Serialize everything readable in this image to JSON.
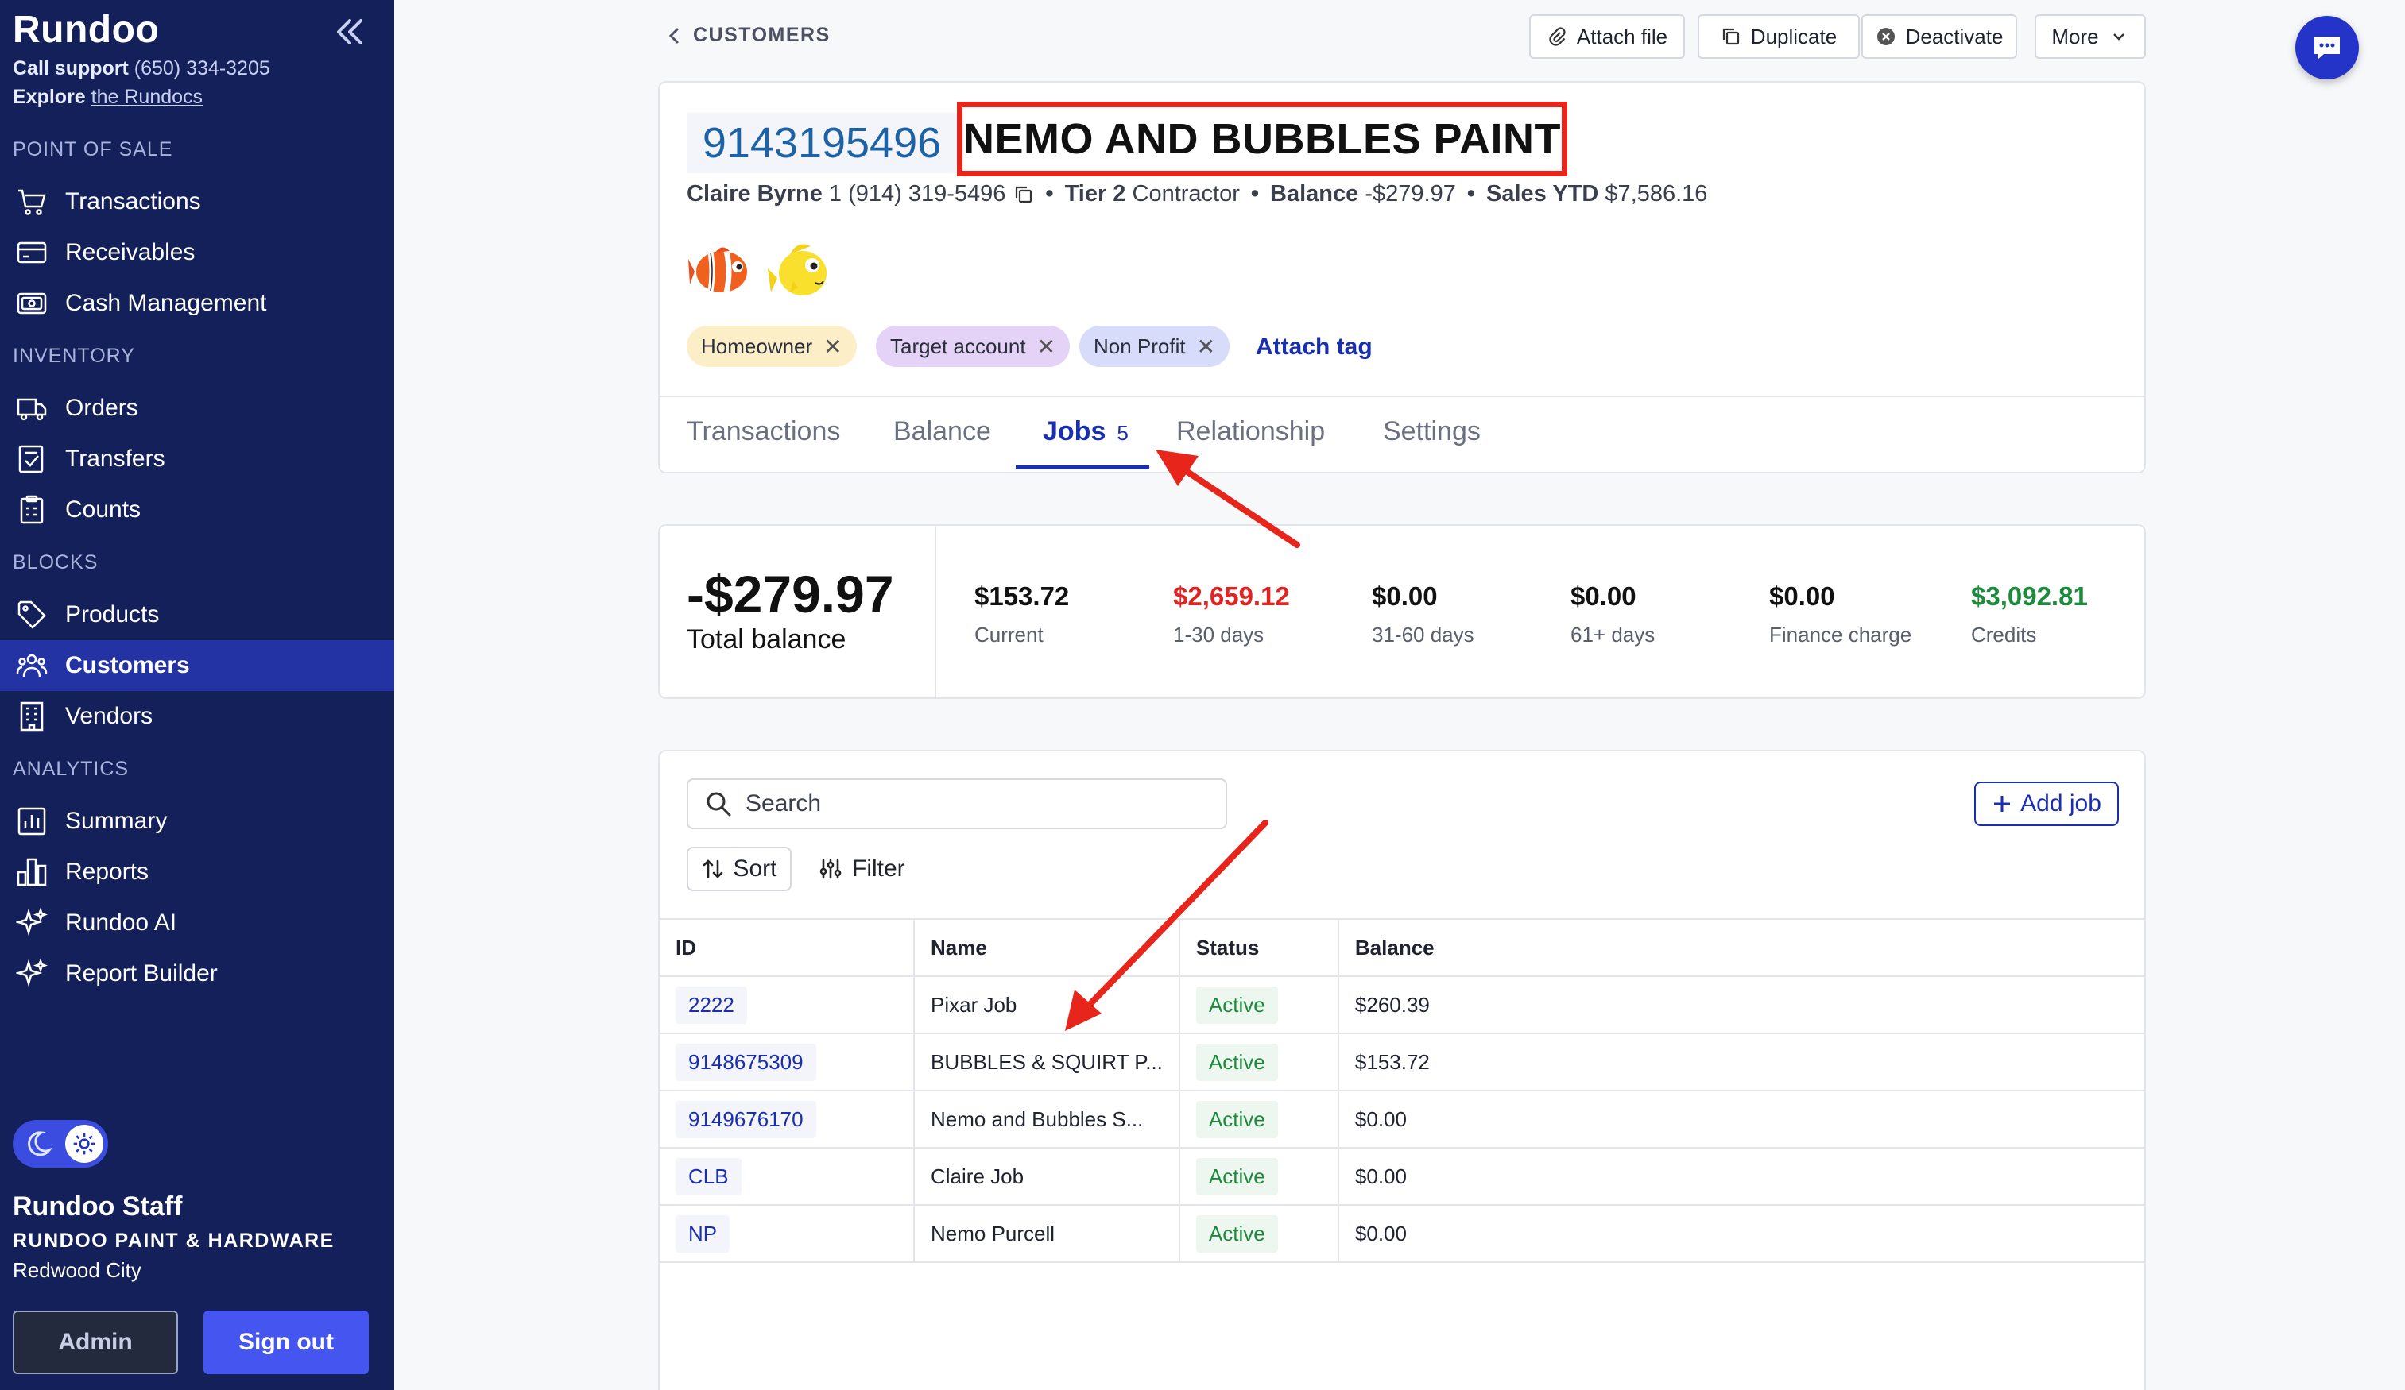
{
  "sidebar": {
    "brand": "Rundoo",
    "support_label": "Call support",
    "support_phone": "(650) 334-3205",
    "explore_label": "Explore",
    "explore_link": "the Rundocs",
    "sections": [
      {
        "label": "POINT OF SALE"
      },
      {
        "label": "INVENTORY"
      },
      {
        "label": "BLOCKS"
      },
      {
        "label": "ANALYTICS"
      }
    ],
    "items": [
      {
        "label": "Transactions",
        "icon": "cart-icon"
      },
      {
        "label": "Receivables",
        "icon": "card-icon"
      },
      {
        "label": "Cash Management",
        "icon": "cash-icon"
      },
      {
        "label": "Orders",
        "icon": "truck-icon"
      },
      {
        "label": "Transfers",
        "icon": "transfer-icon"
      },
      {
        "label": "Counts",
        "icon": "clipboard-icon"
      },
      {
        "label": "Products",
        "icon": "tag-icon"
      },
      {
        "label": "Customers",
        "icon": "users-icon",
        "active": true
      },
      {
        "label": "Vendors",
        "icon": "building-icon"
      },
      {
        "label": "Summary",
        "icon": "chart-icon"
      },
      {
        "label": "Reports",
        "icon": "bars-icon"
      },
      {
        "label": "Rundoo AI",
        "icon": "sparkle-icon"
      },
      {
        "label": "Report Builder",
        "icon": "sparkle-icon"
      }
    ],
    "user_name": "Rundoo Staff",
    "user_org": "RUNDOO PAINT & HARDWARE",
    "user_city": "Redwood City",
    "admin_label": "Admin",
    "signout_label": "Sign out"
  },
  "topbar": {
    "breadcrumb": "CUSTOMERS",
    "attach_file": "Attach file",
    "duplicate": "Duplicate",
    "deactivate": "Deactivate",
    "more": "More"
  },
  "customer": {
    "account_number": "9143195496",
    "name": "NEMO AND BUBBLES PAINT",
    "contact_name": "Claire Byrne",
    "contact_phone": "1 (914) 319-5496",
    "tier_label": "Tier 2",
    "tier_type": "Contractor",
    "balance_label": "Balance",
    "balance_value": "-$279.97",
    "sales_label": "Sales YTD",
    "sales_value": "$7,586.16",
    "tags": [
      {
        "label": "Homeowner",
        "color": "#fcefc7"
      },
      {
        "label": "Target account",
        "color": "#e4d3f6"
      },
      {
        "label": "Non Profit",
        "color": "#d6dcfa"
      }
    ],
    "attach_tag": "Attach tag"
  },
  "tabs": [
    {
      "label": "Transactions"
    },
    {
      "label": "Balance"
    },
    {
      "label": "Jobs",
      "count": "5",
      "active": true
    },
    {
      "label": "Relationship"
    },
    {
      "label": "Settings"
    }
  ],
  "balance": {
    "total": "-$279.97",
    "total_label": "Total balance",
    "buckets": [
      {
        "value": "$153.72",
        "label": "Current"
      },
      {
        "value": "$2,659.12",
        "label": "1-30 days"
      },
      {
        "value": "$0.00",
        "label": "31-60 days"
      },
      {
        "value": "$0.00",
        "label": "61+ days"
      },
      {
        "value": "$0.00",
        "label": "Finance charge"
      },
      {
        "value": "$3,092.81",
        "label": "Credits"
      }
    ]
  },
  "jobs": {
    "search_placeholder": "Search",
    "add_job": "Add job",
    "sort": "Sort",
    "filter": "Filter",
    "columns": [
      "ID",
      "Name",
      "Status",
      "Balance"
    ],
    "rows": [
      {
        "id": "2222",
        "name": "Pixar Job",
        "status": "Active",
        "balance": "$260.39"
      },
      {
        "id": "9148675309",
        "name": "BUBBLES & SQUIRT P...",
        "status": "Active",
        "balance": "$153.72"
      },
      {
        "id": "9149676170",
        "name": "Nemo and Bubbles S...",
        "status": "Active",
        "balance": "$0.00"
      },
      {
        "id": "CLB",
        "name": "Claire Job",
        "status": "Active",
        "balance": "$0.00"
      },
      {
        "id": "NP",
        "name": "Nemo Purcell",
        "status": "Active",
        "balance": "$0.00"
      }
    ]
  },
  "colors": {
    "sidebar_bg": "#14205a",
    "accent": "#1a2fb0",
    "annotation": "#e8251b",
    "overdue": "#e02424",
    "credit": "#1e8a3e"
  }
}
